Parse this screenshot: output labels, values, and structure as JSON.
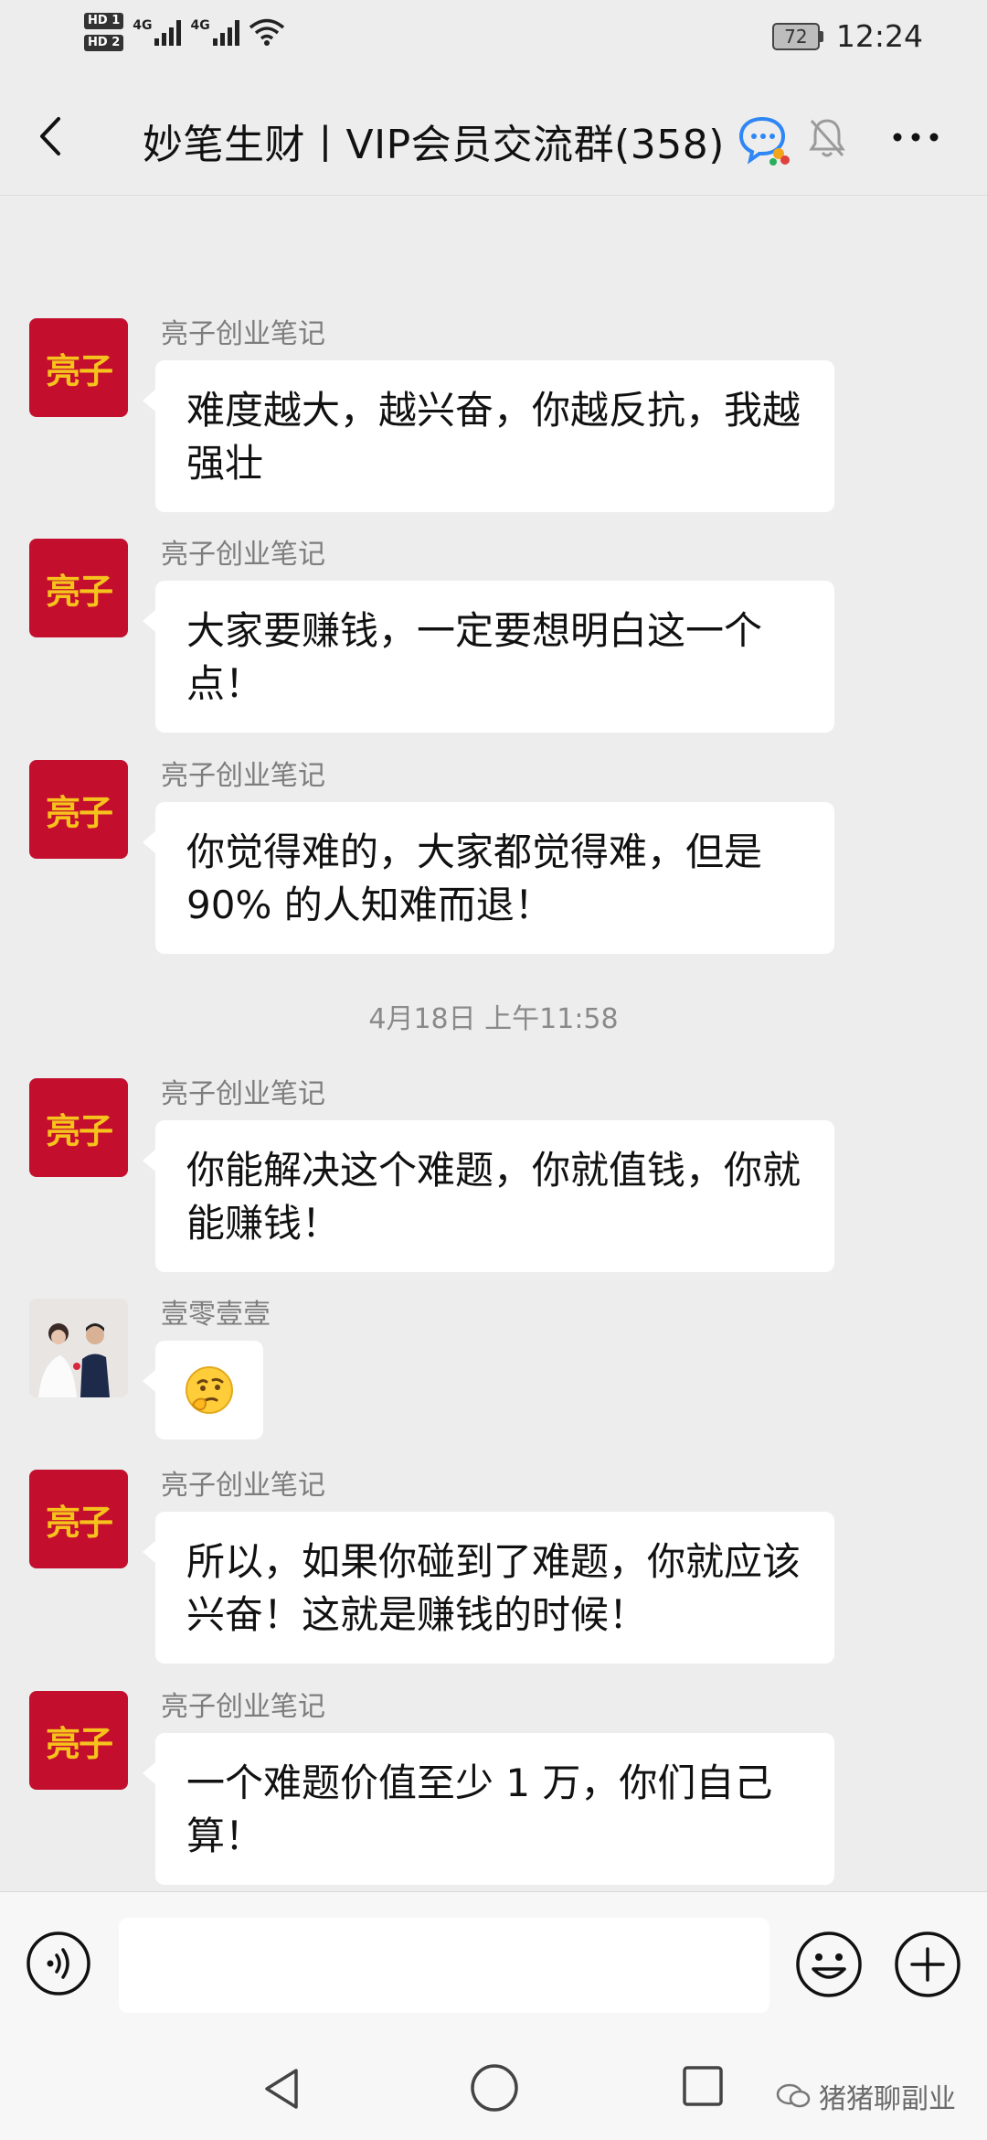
{
  "status_bar": {
    "sim_badges": [
      "HD 1",
      "HD 2"
    ],
    "network_labels": [
      "4G",
      "4G"
    ],
    "battery": "72",
    "time": "12:24"
  },
  "header": {
    "title": "妙笔生财丨VIP会员交流群(358)",
    "icons": [
      "back-arrow-icon",
      "chat-ai-icon",
      "mute-bell-icon",
      "more-dots-icon"
    ]
  },
  "messages": [
    {
      "sender": "亮子创业笔记",
      "avatar_text": "亮子",
      "text": "难度越大，越兴奋，你越反抗，我越强壮"
    },
    {
      "sender": "亮子创业笔记",
      "avatar_text": "亮子",
      "text": "大家要赚钱，一定要想明白这一个点！"
    },
    {
      "sender": "亮子创业笔记",
      "avatar_text": "亮子",
      "text": "你觉得难的，大家都觉得难，但是 90% 的人知难而退！"
    },
    {
      "timestamp": "4月18日 上午11:58"
    },
    {
      "sender": "亮子创业笔记",
      "avatar_text": "亮子",
      "text": "你能解决这个难题，你就值钱，你就能赚钱！"
    },
    {
      "sender": "壹零壹壹",
      "emoji": "thinking-face-emoji"
    },
    {
      "sender": "亮子创业笔记",
      "avatar_text": "亮子",
      "text": "所以，如果你碰到了难题，你就应该兴奋！这就是赚钱的时候！"
    },
    {
      "sender": "亮子创业笔记",
      "avatar_text": "亮子",
      "text": "一个难题价值至少 1 万，你们自己算！"
    }
  ],
  "input_bar": {
    "value": "",
    "icons": [
      "voice-icon",
      "emoji-icon",
      "plus-icon"
    ]
  },
  "nav_bar": {
    "icons": [
      "nav-back-icon",
      "nav-home-icon",
      "nav-recent-icon"
    ]
  },
  "watermark": {
    "text": "猪猪聊副业"
  }
}
